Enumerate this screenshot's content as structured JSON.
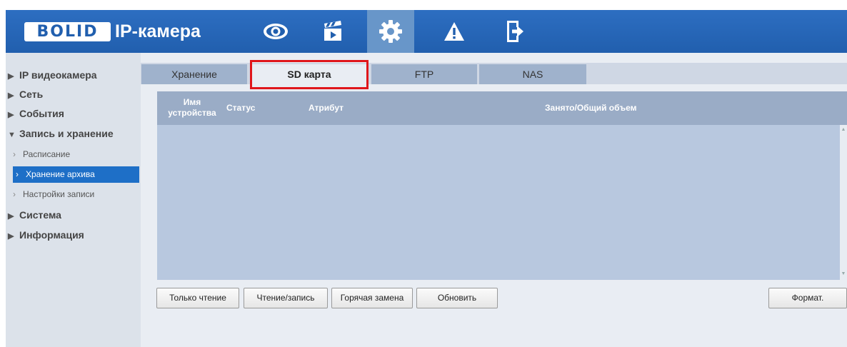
{
  "header": {
    "logo_text": "BOLID",
    "brand": "IP-камера",
    "nav": [
      {
        "icon": "eye-icon"
      },
      {
        "icon": "clapperboard-icon"
      },
      {
        "icon": "gear-icon",
        "active": true
      },
      {
        "icon": "warning-icon"
      },
      {
        "icon": "exit-icon"
      }
    ],
    "color": "#2563b5"
  },
  "sidebar": {
    "items": [
      {
        "label": "IP видеокамера",
        "marker": "▶"
      },
      {
        "label": "Сеть",
        "marker": "▶"
      },
      {
        "label": "События",
        "marker": "▶"
      },
      {
        "label": "Запись и хранение",
        "marker": "▼"
      },
      {
        "label": "Система",
        "marker": "▶"
      },
      {
        "label": "Информация",
        "marker": "▶"
      }
    ],
    "sub_items": [
      {
        "label": "Расписание"
      },
      {
        "label": "Хранение архива",
        "active": true
      },
      {
        "label": "Настройки записи"
      }
    ],
    "sub_marker": "›",
    "active_color": "#1e6fc7"
  },
  "tabs": [
    {
      "label": "Хранение"
    },
    {
      "label": "SD карта",
      "active": true
    },
    {
      "label": "FTP"
    },
    {
      "label": "NAS"
    }
  ],
  "table": {
    "columns": [
      "Имя\nустройства",
      "Статус",
      "Атрибут",
      "Занято/Общий объем"
    ],
    "col_name_line1": "Имя",
    "col_name_line2": "устройства",
    "rows": []
  },
  "buttons": {
    "read_only": "Только чтение",
    "read_write": "Чтение/запись",
    "hot_swap": "Горячая замена",
    "refresh": "Обновить",
    "format": "Формат."
  },
  "highlight_color": "#e0161b"
}
